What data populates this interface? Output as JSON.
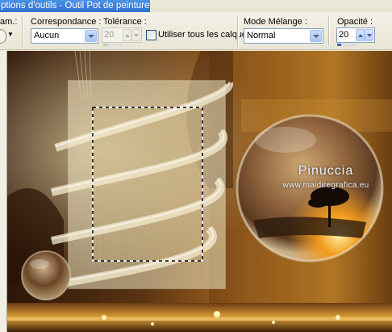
{
  "window": {
    "title": "ptions d'outils - Outil Pot de peinture"
  },
  "toolbar": {
    "presets_label": "am.:",
    "match_mode": {
      "label": "Correspondance :",
      "value": "Aucun"
    },
    "tolerance": {
      "label": "Tolérance :",
      "value": "20",
      "enabled": false,
      "level_percent": 20
    },
    "use_all_layers": {
      "label": "Utiliser tous les calques",
      "checked": false
    },
    "blend_mode": {
      "label": "Mode Mélange :",
      "value": "Normal"
    },
    "opacity": {
      "label": "Opacité :",
      "value": "20",
      "level_percent": 20
    },
    "colors": {
      "accent": "#316ac5",
      "slider": "#2e5fd6"
    }
  },
  "canvas": {
    "watermark": {
      "name": "Pinuccia",
      "url": "www.maidiregrafica.eu"
    },
    "selection": "marching-ants-rectangle",
    "colors": {
      "background_dark": "#3a2010",
      "background_gold": "#c8862a",
      "frame_cream": "#efe6c2"
    }
  }
}
